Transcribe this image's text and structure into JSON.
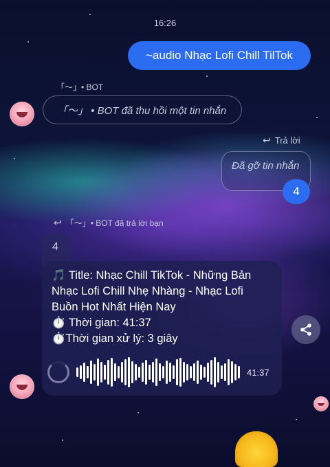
{
  "status": {
    "time": "16:26"
  },
  "messages": {
    "outgoing_command": "~audio Nhạc Lofi Chill TilTok",
    "bot_sender_1": "「～」• BOT",
    "recall_notice": "「～」 • BOT đã thu hồi một tin nhắn",
    "reply_label": "Trả lời",
    "deleted_text": "Đã gỡ tin nhắn",
    "deleted_reaction_count": "4",
    "bot_replied_label": "「～」• BOT đã trả lời bạn",
    "quoted_text": "4",
    "audio_lines": [
      "🎵 Title: Nhạc Chill TikTok - Những Bản",
      "Nhạc Lofi Chill Nhẹ Nhàng - Nhạc Lofi",
      "Buồn Hot Nhất Hiện Nay",
      "⏱️ Thời gian: 41:37",
      "⏱️Thời gian xử lý: 3 giây"
    ],
    "audio_duration": "41:37"
  },
  "icons": {
    "reply": "reply-arrow-icon",
    "share": "share-icon",
    "loading": "loading-spinner-icon"
  },
  "colors": {
    "accent_blue": "#2b6cf0",
    "card_bg": "#1e2054"
  }
}
